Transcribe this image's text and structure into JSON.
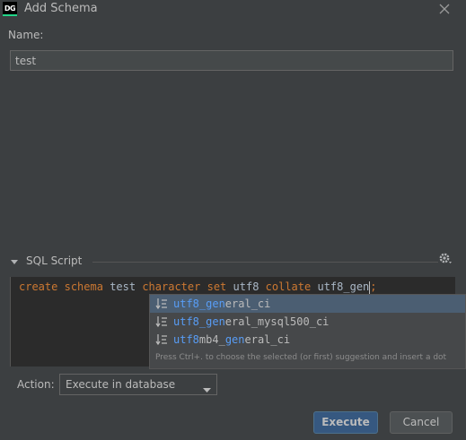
{
  "window": {
    "title": "Add Schema",
    "app_icon_text": "DG"
  },
  "name_field": {
    "label": "Name:",
    "value": "test"
  },
  "sql_section": {
    "label": "SQL Script"
  },
  "editor": {
    "tokens": {
      "t1": "create",
      "t2": "schema",
      "t3": "test",
      "t4": "character",
      "t5": "set",
      "t6": "utf8",
      "t7": "collate",
      "t8": "utf8_gen",
      "t9": ";"
    }
  },
  "suggestions": {
    "items": [
      {
        "match1": "utf8_gen",
        "rest1": "eral_ci",
        "match2": "",
        "rest2": ""
      },
      {
        "match1": "utf8_gen",
        "rest1": "eral_mysql500_ci",
        "match2": "",
        "rest2": ""
      },
      {
        "match1": "utf8",
        "rest1": "mb4_",
        "match2": "gen",
        "rest2": "eral_ci"
      }
    ],
    "hint": "Press Ctrl+. to choose the selected (or first) suggestion and insert a dot"
  },
  "action": {
    "label": "Action:",
    "value": "Execute in database"
  },
  "buttons": {
    "execute": "Execute",
    "cancel": "Cancel"
  },
  "colors": {
    "keyword": "#cc7832",
    "match_highlight": "#589df6",
    "primary_button": "#365880",
    "background": "#3c3f41",
    "editor_bg": "#2b2b2b"
  }
}
